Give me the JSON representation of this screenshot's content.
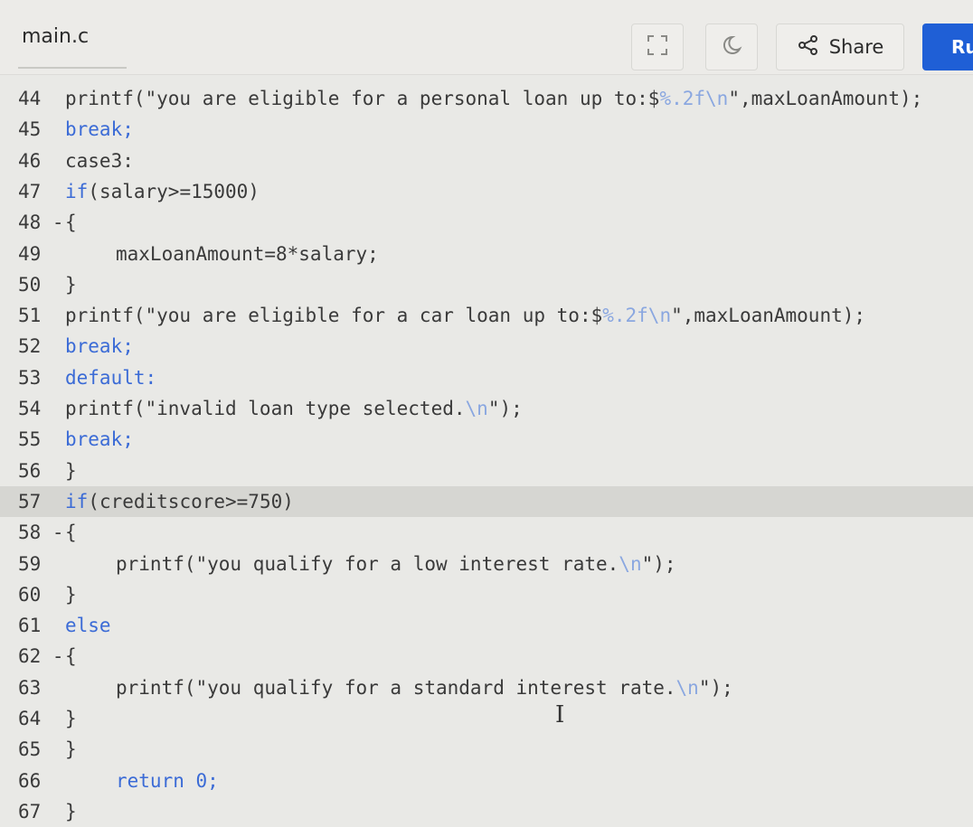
{
  "header": {
    "filename": "main.c",
    "share_label": "Share",
    "run_label": "Ru"
  },
  "editor": {
    "lines": [
      {
        "n": "44",
        "parts": [
          {
            "t": "printf(\"you are eligible for a personal loan up to:$",
            "c": "s"
          },
          {
            "t": "%.2f\\n",
            "c": "e"
          },
          {
            "t": "\",maxLoanAmount);",
            "c": "s"
          }
        ]
      },
      {
        "n": "45",
        "parts": [
          {
            "t": "break;",
            "c": "k"
          }
        ]
      },
      {
        "n": "46",
        "parts": [
          {
            "t": "case3:",
            "c": "s"
          }
        ]
      },
      {
        "n": "47",
        "parts": [
          {
            "t": "if",
            "c": "k"
          },
          {
            "t": "(salary>=15000)",
            "c": "s"
          }
        ]
      },
      {
        "n": "48 -",
        "parts": [
          {
            "t": "{",
            "c": "s"
          }
        ]
      },
      {
        "n": "49",
        "indent": true,
        "parts": [
          {
            "t": "maxLoanAmount=8*salary;",
            "c": "s"
          }
        ]
      },
      {
        "n": "50",
        "parts": [
          {
            "t": "}",
            "c": "s"
          }
        ]
      },
      {
        "n": "51",
        "parts": [
          {
            "t": "printf(\"you are eligible for a car loan up to:$",
            "c": "s"
          },
          {
            "t": "%.2f\\n",
            "c": "e"
          },
          {
            "t": "\",maxLoanAmount);",
            "c": "s"
          }
        ]
      },
      {
        "n": "52",
        "parts": [
          {
            "t": "break;",
            "c": "k"
          }
        ]
      },
      {
        "n": "53",
        "parts": [
          {
            "t": "default:",
            "c": "k"
          }
        ]
      },
      {
        "n": "54",
        "parts": [
          {
            "t": "printf(\"invalid loan type selected.",
            "c": "s"
          },
          {
            "t": "\\n",
            "c": "e"
          },
          {
            "t": "\");",
            "c": "s"
          }
        ]
      },
      {
        "n": "55",
        "parts": [
          {
            "t": "break;",
            "c": "k"
          }
        ]
      },
      {
        "n": "56",
        "parts": [
          {
            "t": "}",
            "c": "s"
          }
        ]
      },
      {
        "n": "57",
        "active": true,
        "parts": [
          {
            "t": "if",
            "c": "k"
          },
          {
            "t": "(creditscore>=750)",
            "c": "s"
          }
        ]
      },
      {
        "n": "58 -",
        "parts": [
          {
            "t": "{",
            "c": "s"
          }
        ]
      },
      {
        "n": "59",
        "indent": true,
        "parts": [
          {
            "t": "printf(\"you qualify for a low interest rate.",
            "c": "s"
          },
          {
            "t": "\\n",
            "c": "e"
          },
          {
            "t": "\");",
            "c": "s"
          }
        ]
      },
      {
        "n": "60",
        "parts": [
          {
            "t": "}",
            "c": "s"
          }
        ]
      },
      {
        "n": "61",
        "parts": [
          {
            "t": "else",
            "c": "k"
          }
        ]
      },
      {
        "n": "62 -",
        "parts": [
          {
            "t": "{",
            "c": "s"
          }
        ]
      },
      {
        "n": "63",
        "indent": true,
        "parts": [
          {
            "t": "printf(\"you qualify for a standard interest rate.",
            "c": "s"
          },
          {
            "t": "\\n",
            "c": "e"
          },
          {
            "t": "\");",
            "c": "s"
          }
        ]
      },
      {
        "n": "64",
        "parts": [
          {
            "t": "}",
            "c": "s"
          }
        ]
      },
      {
        "n": "65",
        "parts": [
          {
            "t": "}",
            "c": "s"
          }
        ]
      },
      {
        "n": "66",
        "indent": true,
        "parts": [
          {
            "t": "return 0;",
            "c": "k"
          }
        ]
      },
      {
        "n": "67",
        "parts": [
          {
            "t": "}",
            "c": "s"
          }
        ]
      }
    ]
  },
  "colors": {
    "run_button": "#1f5fd6",
    "keyword": "#3b6bd6",
    "escape": "#8aa7e0",
    "active_line": "#d6d6d2"
  },
  "icons": [
    "fullscreen-icon",
    "theme-toggle-icon",
    "share-icon",
    "text-cursor-icon"
  ]
}
